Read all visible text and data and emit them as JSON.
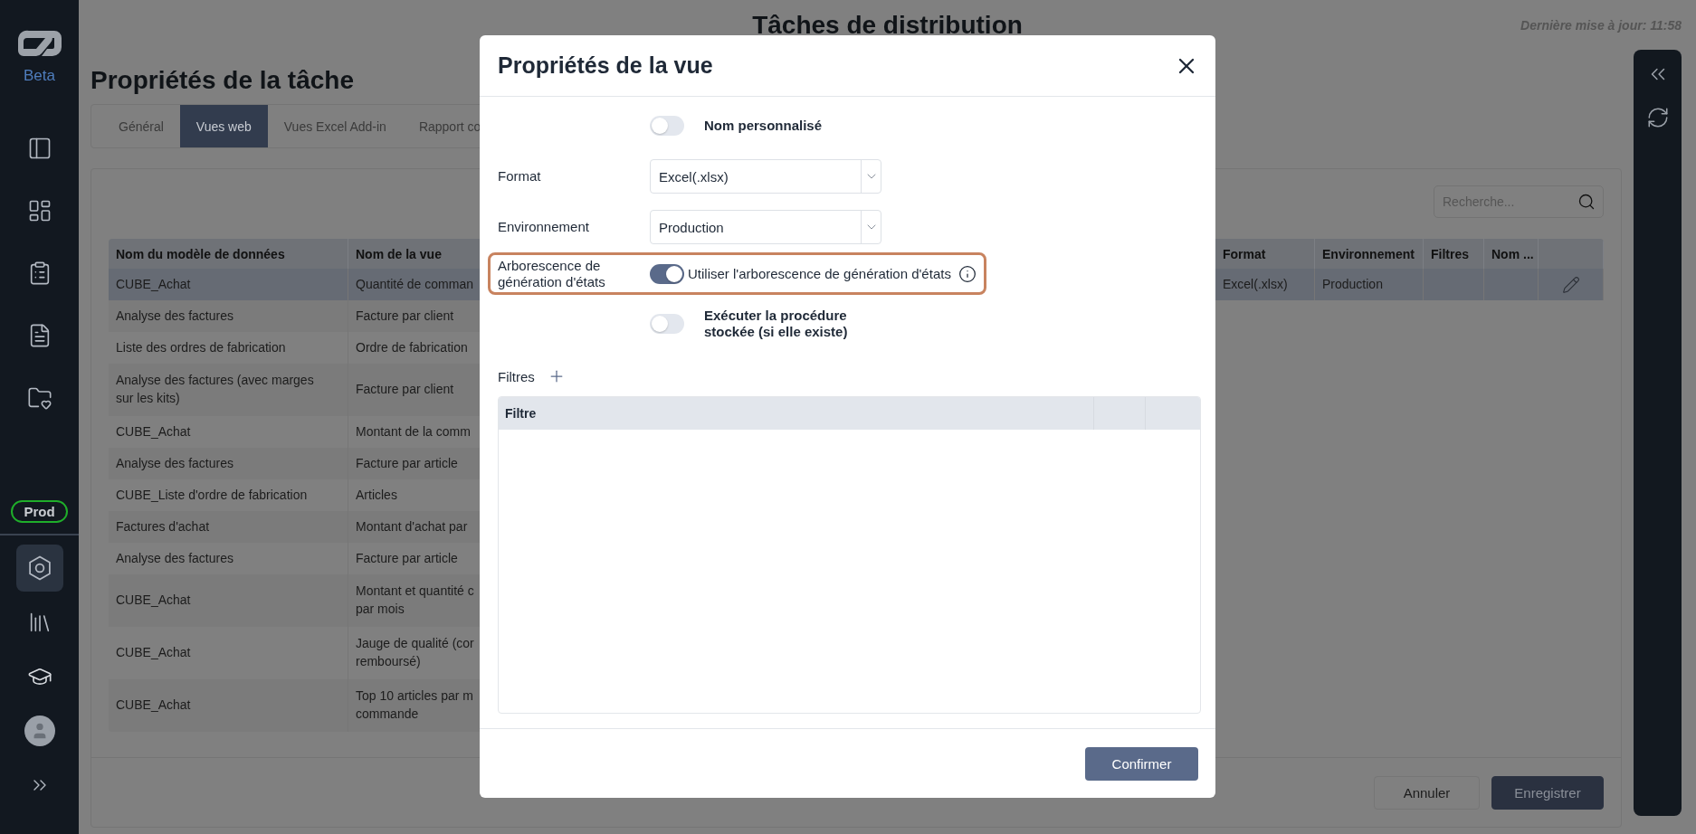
{
  "sidebar": {
    "logo_label": "Beta",
    "environment_badge": "Prod",
    "items": [
      {
        "kind": "panel",
        "selected": false
      },
      {
        "kind": "dashboard",
        "selected": false
      },
      {
        "kind": "clipboard",
        "selected": false
      },
      {
        "kind": "invoice",
        "selected": false
      },
      {
        "kind": "folder",
        "selected": false
      }
    ],
    "bottom_items": [
      {
        "kind": "hexagon",
        "selected": true
      },
      {
        "kind": "library",
        "selected": false
      },
      {
        "kind": "graduation",
        "selected": false
      },
      {
        "kind": "avatar",
        "selected": false
      },
      {
        "kind": "expand",
        "selected": false
      }
    ]
  },
  "header": {
    "title": "Tâches de distribution",
    "last_update": "Dernière mise à jour: 11:58"
  },
  "page_title": "Propriétés de la tâche",
  "tabs": [
    {
      "label": "Général",
      "selected": false
    },
    {
      "label": "Vues web",
      "selected": true
    },
    {
      "label": "Vues Excel Add-in",
      "selected": false
    },
    {
      "label": "Rapport co",
      "selected": false
    }
  ],
  "search": {
    "placeholder": "Recherche..."
  },
  "table": {
    "columns": [
      "Nom du modèle de données",
      "Nom de la vue",
      "Format",
      "Environnement",
      "Filtres",
      "Nom ..."
    ],
    "rows": [
      {
        "model": "CUBE_Achat",
        "view": "Quantité de comman",
        "format": "Excel(.xlsx)",
        "environment": "Production",
        "editable": true,
        "selected": true
      },
      {
        "model": "Analyse des factures",
        "view": "Facture par client",
        "selected": false
      },
      {
        "model": "Liste des ordres de fabrication",
        "view": "Ordre de fabrication",
        "selected": false
      },
      {
        "model": "Analyse des factures (avec marges\nsur les kits)",
        "view": "Facture par client",
        "selected": false
      },
      {
        "model": "CUBE_Achat",
        "view": "Montant de la comm",
        "selected": false
      },
      {
        "model": "Analyse des factures",
        "view": "Facture par article",
        "selected": false
      },
      {
        "model": "CUBE_Liste d'ordre de fabrication",
        "view": "Articles",
        "selected": false
      },
      {
        "model": "Factures d'achat",
        "view": "Montant d'achat par",
        "selected": false
      },
      {
        "model": "Analyse des factures",
        "view": "Facture par article",
        "selected": false
      },
      {
        "model": "CUBE_Achat",
        "view": "Montant et quantité c\npar mois",
        "selected": false
      },
      {
        "model": "CUBE_Achat",
        "view": "Jauge de qualité (cor\nremboursé)",
        "selected": false
      },
      {
        "model": "CUBE_Achat",
        "view": "Top 10 articles par m\ncommande",
        "selected": false
      }
    ]
  },
  "footer_buttons": [
    {
      "label": "Annuler",
      "kind": "secondary"
    },
    {
      "label": "Enregistrer",
      "kind": "primary"
    }
  ],
  "modal": {
    "title": "Propriétés de la vue",
    "fields": [
      {
        "kind": "toggle",
        "on": false,
        "text": "Nom personnalisé"
      },
      {
        "kind": "select",
        "label": "Format",
        "value": "Excel(.xlsx)"
      },
      {
        "kind": "select",
        "label": "Environnement",
        "value": "Production"
      },
      {
        "kind": "toggle",
        "label": "Arborescence de génération d'états",
        "on": true,
        "text": "Utiliser l'arborescence de génération d'états",
        "highlighted": true,
        "info": true
      },
      {
        "kind": "toggle",
        "on": false,
        "text": "Exécuter la procédure stockée (si elle existe)"
      }
    ],
    "filters": {
      "label": "Filtres",
      "columns": [
        "Filtre"
      ]
    },
    "confirm": "Confirmer"
  }
}
